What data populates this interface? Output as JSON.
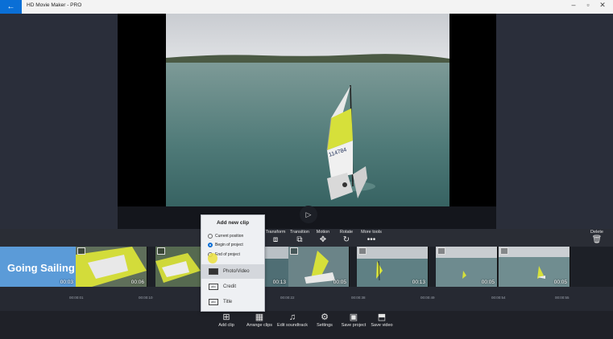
{
  "window": {
    "title": "HD Movie Maker - PRO",
    "back_glyph": "←",
    "minimize_glyph": "–",
    "maximize_glyph": "▫",
    "close_glyph": "✕"
  },
  "player": {
    "play_glyph": "▷",
    "sail_number": "114784"
  },
  "toolbar": {
    "transform": "Transform",
    "transition": "Transition",
    "motion": "Motion",
    "rotate": "Rotate",
    "more_tools": "More tools",
    "delete": "Delete"
  },
  "timeline": {
    "title_clip_text": "Going Sailing",
    "clips": [
      {
        "duration": "00:03"
      },
      {
        "duration": "00:06"
      },
      {
        "duration": ""
      },
      {
        "duration": "00:13"
      },
      {
        "duration": "00:05"
      },
      {
        "duration": "00:13"
      },
      {
        "duration": "00:05"
      },
      {
        "duration": "00:05"
      }
    ],
    "ticks": [
      "00:00:01",
      "00:00:10",
      "00:00:22",
      "00:00:38",
      "00:00:49",
      "00:00:54",
      "00:00:55"
    ]
  },
  "popup": {
    "title": "Add new clip",
    "options": [
      "Current position",
      "Begin of project",
      "End of project"
    ],
    "items": [
      {
        "label": "Photo/Video",
        "icon": "photo-video-icon",
        "badge": ""
      },
      {
        "label": "Credit",
        "icon": "credit-icon",
        "badge": "abc"
      },
      {
        "label": "Title",
        "icon": "title-icon",
        "badge": "abc"
      }
    ]
  },
  "bottom_bar": {
    "add_clip": "Add clip",
    "arrange_clips": "Arrange clips",
    "edit_soundtrack": "Edit soundtrack",
    "settings": "Settings",
    "save_project": "Save project",
    "save_video": "Save video"
  },
  "colors": {
    "accent": "#0a6fd6",
    "title_clip": "#5b9bd8",
    "sail_yellow": "#d6e03a"
  }
}
